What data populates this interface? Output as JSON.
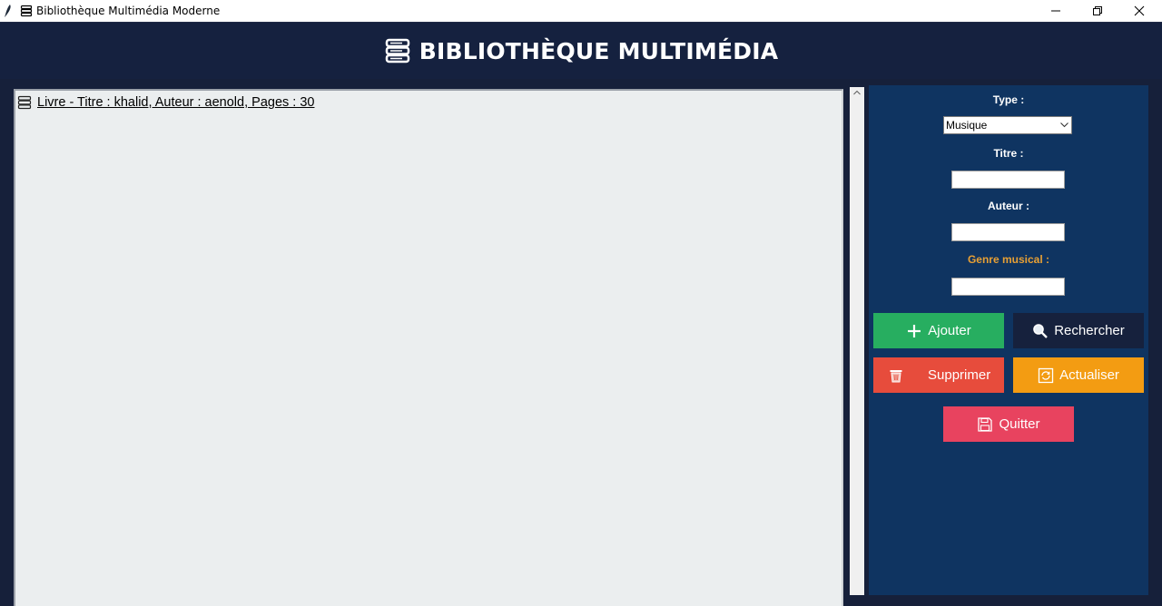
{
  "window": {
    "title": "Bibliothèque Multimédia Moderne",
    "controls": [
      "minimize-icon",
      "restore-icon",
      "close-icon"
    ]
  },
  "header": {
    "title": "BIBLIOTHÈQUE MULTIMÉDIA",
    "icon": "books-icon"
  },
  "list": {
    "items": [
      {
        "icon": "books-icon",
        "text": "Livre - Titre : khalid, Auteur : aenold, Pages : 30"
      }
    ]
  },
  "form": {
    "type_label": "Type :",
    "type_value": "Musique",
    "title_label": "Titre :",
    "title_value": "",
    "author_label": "Auteur :",
    "author_value": "",
    "genre_label": "Genre musical :",
    "genre_value": ""
  },
  "buttons": {
    "add": "Ajouter",
    "search": "Rechercher",
    "delete": "Supprimer",
    "refresh": "Actualiser",
    "quit": "Quitter"
  },
  "colors": {
    "background": "#16203a",
    "panel": "#0f3461",
    "add": "#27ae60",
    "search": "#16213d",
    "delete": "#e74c3c",
    "refresh": "#f39c12",
    "quit": "#e8435f",
    "genre_label": "#e8a034"
  }
}
